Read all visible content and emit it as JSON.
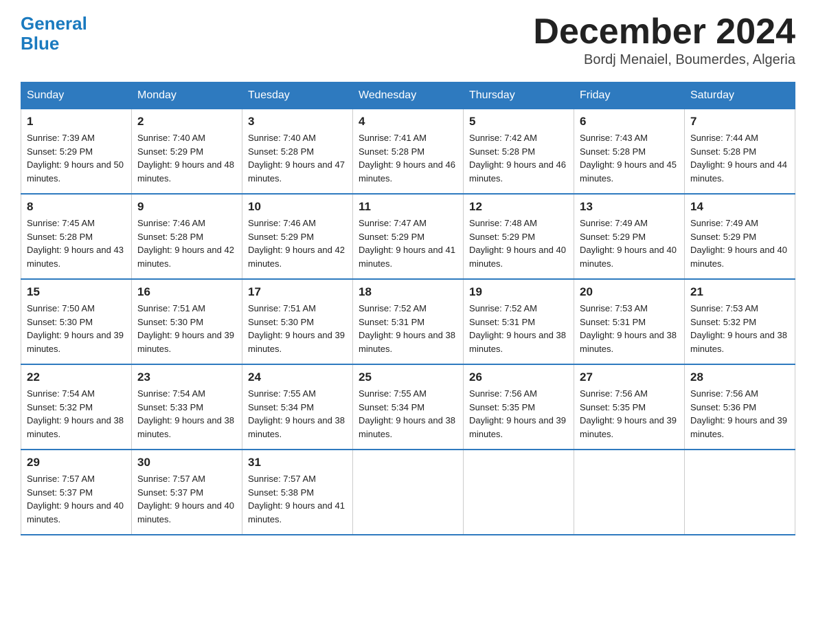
{
  "header": {
    "logo_general": "General",
    "logo_blue": "Blue",
    "month_title": "December 2024",
    "location": "Bordj Menaiel, Boumerdes, Algeria"
  },
  "days_of_week": [
    "Sunday",
    "Monday",
    "Tuesday",
    "Wednesday",
    "Thursday",
    "Friday",
    "Saturday"
  ],
  "weeks": [
    [
      {
        "day": "1",
        "sunrise": "7:39 AM",
        "sunset": "5:29 PM",
        "daylight": "9 hours and 50 minutes."
      },
      {
        "day": "2",
        "sunrise": "7:40 AM",
        "sunset": "5:29 PM",
        "daylight": "9 hours and 48 minutes."
      },
      {
        "day": "3",
        "sunrise": "7:40 AM",
        "sunset": "5:28 PM",
        "daylight": "9 hours and 47 minutes."
      },
      {
        "day": "4",
        "sunrise": "7:41 AM",
        "sunset": "5:28 PM",
        "daylight": "9 hours and 46 minutes."
      },
      {
        "day": "5",
        "sunrise": "7:42 AM",
        "sunset": "5:28 PM",
        "daylight": "9 hours and 46 minutes."
      },
      {
        "day": "6",
        "sunrise": "7:43 AM",
        "sunset": "5:28 PM",
        "daylight": "9 hours and 45 minutes."
      },
      {
        "day": "7",
        "sunrise": "7:44 AM",
        "sunset": "5:28 PM",
        "daylight": "9 hours and 44 minutes."
      }
    ],
    [
      {
        "day": "8",
        "sunrise": "7:45 AM",
        "sunset": "5:28 PM",
        "daylight": "9 hours and 43 minutes."
      },
      {
        "day": "9",
        "sunrise": "7:46 AM",
        "sunset": "5:28 PM",
        "daylight": "9 hours and 42 minutes."
      },
      {
        "day": "10",
        "sunrise": "7:46 AM",
        "sunset": "5:29 PM",
        "daylight": "9 hours and 42 minutes."
      },
      {
        "day": "11",
        "sunrise": "7:47 AM",
        "sunset": "5:29 PM",
        "daylight": "9 hours and 41 minutes."
      },
      {
        "day": "12",
        "sunrise": "7:48 AM",
        "sunset": "5:29 PM",
        "daylight": "9 hours and 40 minutes."
      },
      {
        "day": "13",
        "sunrise": "7:49 AM",
        "sunset": "5:29 PM",
        "daylight": "9 hours and 40 minutes."
      },
      {
        "day": "14",
        "sunrise": "7:49 AM",
        "sunset": "5:29 PM",
        "daylight": "9 hours and 40 minutes."
      }
    ],
    [
      {
        "day": "15",
        "sunrise": "7:50 AM",
        "sunset": "5:30 PM",
        "daylight": "9 hours and 39 minutes."
      },
      {
        "day": "16",
        "sunrise": "7:51 AM",
        "sunset": "5:30 PM",
        "daylight": "9 hours and 39 minutes."
      },
      {
        "day": "17",
        "sunrise": "7:51 AM",
        "sunset": "5:30 PM",
        "daylight": "9 hours and 39 minutes."
      },
      {
        "day": "18",
        "sunrise": "7:52 AM",
        "sunset": "5:31 PM",
        "daylight": "9 hours and 38 minutes."
      },
      {
        "day": "19",
        "sunrise": "7:52 AM",
        "sunset": "5:31 PM",
        "daylight": "9 hours and 38 minutes."
      },
      {
        "day": "20",
        "sunrise": "7:53 AM",
        "sunset": "5:31 PM",
        "daylight": "9 hours and 38 minutes."
      },
      {
        "day": "21",
        "sunrise": "7:53 AM",
        "sunset": "5:32 PM",
        "daylight": "9 hours and 38 minutes."
      }
    ],
    [
      {
        "day": "22",
        "sunrise": "7:54 AM",
        "sunset": "5:32 PM",
        "daylight": "9 hours and 38 minutes."
      },
      {
        "day": "23",
        "sunrise": "7:54 AM",
        "sunset": "5:33 PM",
        "daylight": "9 hours and 38 minutes."
      },
      {
        "day": "24",
        "sunrise": "7:55 AM",
        "sunset": "5:34 PM",
        "daylight": "9 hours and 38 minutes."
      },
      {
        "day": "25",
        "sunrise": "7:55 AM",
        "sunset": "5:34 PM",
        "daylight": "9 hours and 38 minutes."
      },
      {
        "day": "26",
        "sunrise": "7:56 AM",
        "sunset": "5:35 PM",
        "daylight": "9 hours and 39 minutes."
      },
      {
        "day": "27",
        "sunrise": "7:56 AM",
        "sunset": "5:35 PM",
        "daylight": "9 hours and 39 minutes."
      },
      {
        "day": "28",
        "sunrise": "7:56 AM",
        "sunset": "5:36 PM",
        "daylight": "9 hours and 39 minutes."
      }
    ],
    [
      {
        "day": "29",
        "sunrise": "7:57 AM",
        "sunset": "5:37 PM",
        "daylight": "9 hours and 40 minutes."
      },
      {
        "day": "30",
        "sunrise": "7:57 AM",
        "sunset": "5:37 PM",
        "daylight": "9 hours and 40 minutes."
      },
      {
        "day": "31",
        "sunrise": "7:57 AM",
        "sunset": "5:38 PM",
        "daylight": "9 hours and 41 minutes."
      },
      null,
      null,
      null,
      null
    ]
  ],
  "sunrise_label": "Sunrise:",
  "sunset_label": "Sunset:",
  "daylight_label": "Daylight:"
}
